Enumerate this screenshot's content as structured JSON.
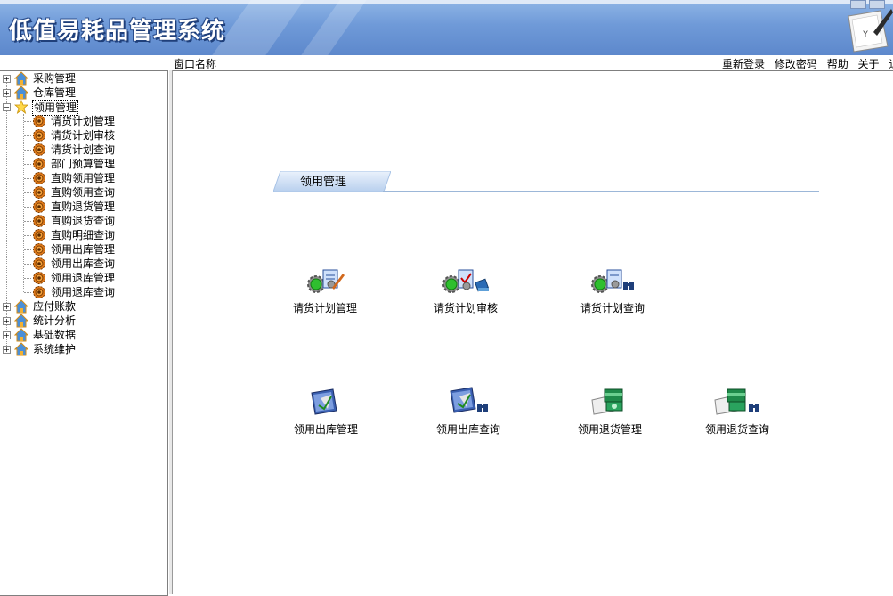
{
  "app": {
    "title": "低值易耗品管理系统"
  },
  "toolbar": {
    "window_name_label": "窗口名称",
    "links": [
      "重新登录",
      "修改密码",
      "帮助",
      "关于",
      "退出"
    ]
  },
  "tree": {
    "top_nodes_before": [
      {
        "label": "采购管理"
      },
      {
        "label": "仓库管理"
      }
    ],
    "selected_node": {
      "label": "领用管理"
    },
    "children": [
      "请货计划管理",
      "请货计划审核",
      "请货计划查询",
      "部门预算管理",
      "直购领用管理",
      "直购领用查询",
      "直购退货管理",
      "直购退货查询",
      "直购明细查询",
      "领用出库管理",
      "领用出库查询",
      "领用退库管理",
      "领用退库查询"
    ],
    "top_nodes_after": [
      {
        "label": "应付账款"
      },
      {
        "label": "统计分析"
      },
      {
        "label": "基础数据"
      },
      {
        "label": "系统维护"
      }
    ]
  },
  "main": {
    "section_title": "领用管理",
    "functions": [
      {
        "label": "请货计划管理",
        "icon": "gear-edit-icon"
      },
      {
        "label": "请货计划审核",
        "icon": "gear-approve-icon"
      },
      {
        "label": "请货计划查询",
        "icon": "gear-search-icon"
      },
      {
        "label": "领用出库管理",
        "icon": "outbound-icon"
      },
      {
        "label": "领用出库查询",
        "icon": "outbound-search-icon"
      },
      {
        "label": "领用退货管理",
        "icon": "return-icon"
      },
      {
        "label": "领用退货查询",
        "icon": "return-search-icon"
      }
    ]
  }
}
